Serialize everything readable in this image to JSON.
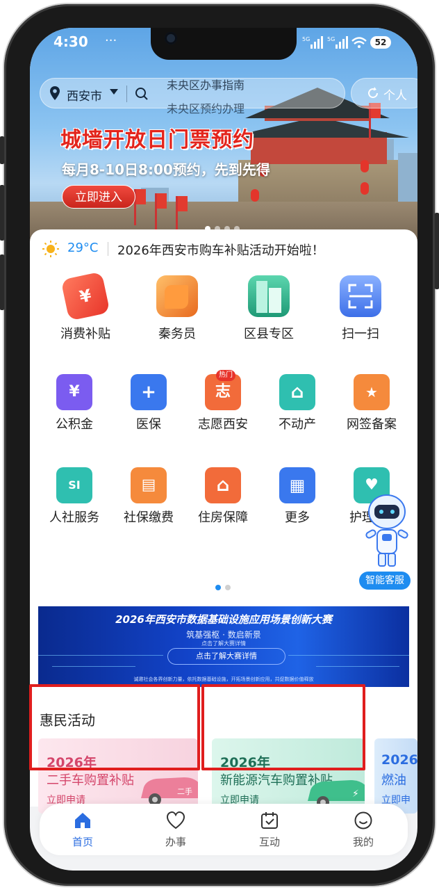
{
  "status_bar": {
    "time": "4:30",
    "dots": "···",
    "battery": "52"
  },
  "topbar": {
    "city": "西安市",
    "search_hints": [
      "未央区办事指南",
      "未央区预约办理"
    ],
    "person_label": "个人"
  },
  "banner": {
    "title": "城墙开放日门票预约",
    "subtitle": "每月8-10日8:00预约，先到先得",
    "button": "立即进入"
  },
  "weather": {
    "temperature": "29°C",
    "notice": "2026年西安市购车补贴活动开始啦！"
  },
  "main_services": [
    {
      "label": "消费补贴",
      "icon": "coupon-icon",
      "color": "#f2553f"
    },
    {
      "label": "秦务员",
      "icon": "qin-logo-icon",
      "color": "#f08a2a"
    },
    {
      "label": "区县专区",
      "icon": "building-icon",
      "color": "#2bb58f"
    },
    {
      "label": "扫一扫",
      "icon": "scan-icon",
      "color": "#4a7ff0"
    }
  ],
  "services": [
    {
      "label": "公积金",
      "icon": "fund-icon",
      "color": "#7b5cf0",
      "glyph": "¥"
    },
    {
      "label": "医保",
      "icon": "medical-icon",
      "color": "#3a78ee",
      "glyph": "+"
    },
    {
      "label": "志愿西安",
      "icon": "volunteer-icon",
      "color": "#f26b3a",
      "glyph": "志",
      "badge": "热门"
    },
    {
      "label": "不动产",
      "icon": "house-icon",
      "color": "#2fbfb0",
      "glyph": "⌂"
    },
    {
      "label": "网签备案",
      "icon": "contract-icon",
      "color": "#f58a3c",
      "glyph": "★"
    },
    {
      "label": "人社服务",
      "icon": "social-security-icon",
      "color": "#2fbfb0",
      "glyph": "SI"
    },
    {
      "label": "社保缴费",
      "icon": "id-card-icon",
      "color": "#f58a3c",
      "glyph": "▤"
    },
    {
      "label": "住房保障",
      "icon": "housing-icon",
      "color": "#f26b3a",
      "glyph": "⌂"
    },
    {
      "label": "更多",
      "icon": "grid-icon",
      "color": "#3a78ee",
      "glyph": "▦"
    },
    {
      "label": "护理",
      "icon": "care-icon",
      "color": "#2fbfb0",
      "glyph": "♥"
    }
  ],
  "assistant": {
    "label": "智能客服"
  },
  "promo": {
    "title": "2026年西安市数据基础设施应用场景创新大赛",
    "subtitle": "筑基强枢 · 数启新景",
    "small": "点击了解大赛详情",
    "button": "点击了解大赛详情",
    "footer": "诚邀社会各界创新力量，依托数据基础设施，开拓场景创新应用，共促数据价值释放"
  },
  "section": {
    "title": "惠民活动"
  },
  "activities": [
    {
      "year": "2026年",
      "title": "二手车购置补贴",
      "action": "立即申请",
      "bg": "#fbe3ea",
      "color": "#d4456a",
      "car_label": "二手"
    },
    {
      "year": "2026年",
      "title": "新能源汽车购置补贴",
      "action": "立即申请",
      "bg": "#d9f3ea",
      "color": "#1f8a6a",
      "car_label": "⚡"
    },
    {
      "year": "2026",
      "title": "燃油",
      "action": "立即申",
      "bg": "#dcecfb",
      "color": "#2b6de0"
    }
  ],
  "tabs": [
    {
      "label": "首页",
      "icon": "home-icon",
      "active": true
    },
    {
      "label": "办事",
      "icon": "heart-icon",
      "active": false
    },
    {
      "label": "互动",
      "icon": "calendar-check-icon",
      "active": false
    },
    {
      "label": "我的",
      "icon": "smile-icon",
      "active": false
    }
  ]
}
